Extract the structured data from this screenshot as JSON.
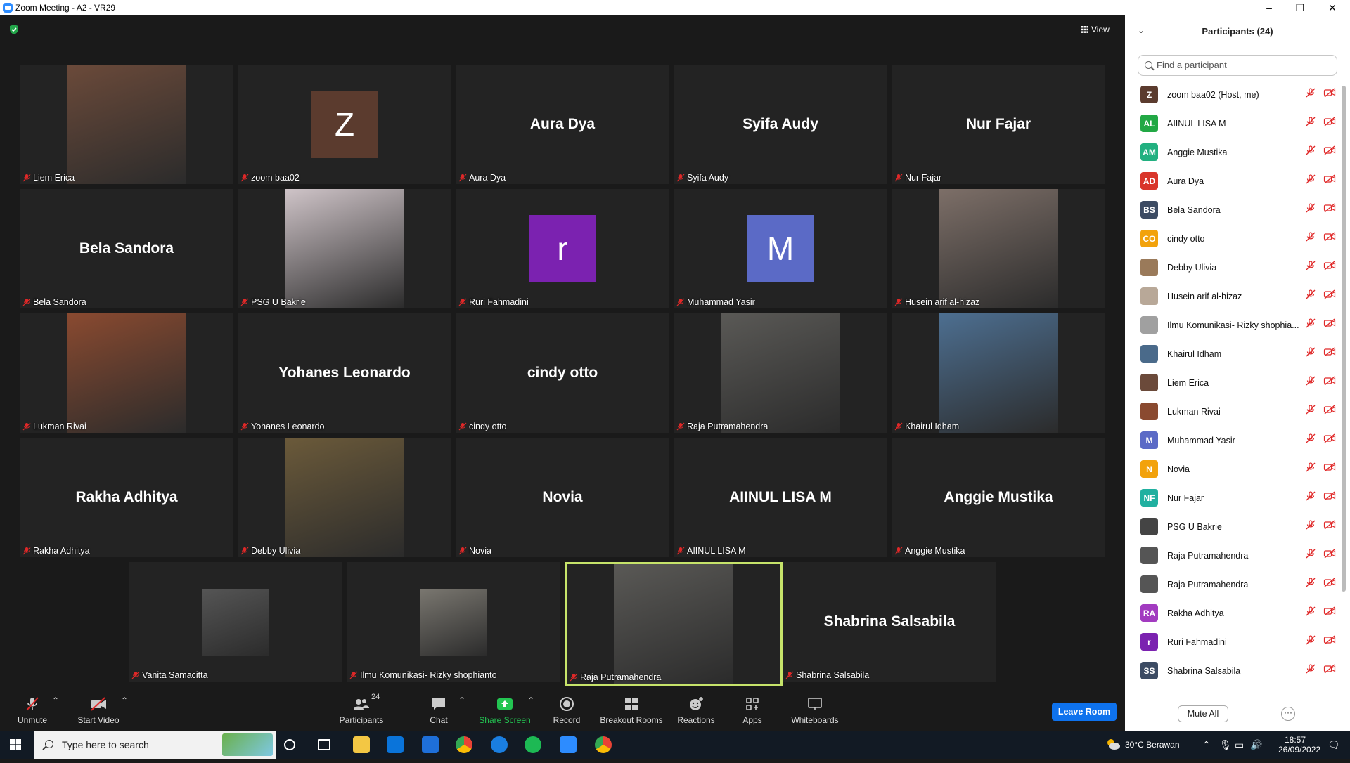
{
  "window": {
    "title": "Zoom Meeting - A2 - VR29"
  },
  "stage": {
    "view_label": "View"
  },
  "tiles": [
    {
      "label": "Liem Erica",
      "big": "",
      "avatar": "",
      "avatar_color": "",
      "photo": "#6b4a3a"
    },
    {
      "label": "zoom baa02",
      "big": "",
      "avatar": "Z",
      "avatar_color": "#5b3b2e",
      "photo": ""
    },
    {
      "label": "Aura Dya",
      "big": "Aura Dya",
      "avatar": "",
      "avatar_color": "",
      "photo": ""
    },
    {
      "label": "Syifa Audy",
      "big": "Syifa Audy",
      "avatar": "",
      "avatar_color": "",
      "photo": ""
    },
    {
      "label": "Nur Fajar",
      "big": "Nur Fajar",
      "avatar": "",
      "avatar_color": "",
      "photo": ""
    },
    {
      "label": "Bela Sandora",
      "big": "Bela Sandora",
      "avatar": "",
      "avatar_color": "",
      "photo": ""
    },
    {
      "label": "PSG U Bakrie",
      "big": "",
      "avatar": "",
      "avatar_color": "",
      "photo": "#cfc4c8"
    },
    {
      "label": "Ruri Fahmadini",
      "big": "",
      "avatar": "r",
      "avatar_color": "#7b22b0",
      "photo": ""
    },
    {
      "label": "Muhammad Yasir",
      "big": "",
      "avatar": "M",
      "avatar_color": "#5b6ac6",
      "photo": ""
    },
    {
      "label": "Husein arif al-hizaz",
      "big": "",
      "avatar": "",
      "avatar_color": "",
      "photo": "#7d6f68"
    },
    {
      "label": "Lukman Rivai",
      "big": "",
      "avatar": "",
      "avatar_color": "",
      "photo": "#8a4a30"
    },
    {
      "label": "Yohanes Leonardo",
      "big": "Yohanes Leonardo",
      "avatar": "",
      "avatar_color": "",
      "photo": ""
    },
    {
      "label": "cindy otto",
      "big": "cindy otto",
      "avatar": "",
      "avatar_color": "",
      "photo": ""
    },
    {
      "label": "Raja Putramahendra",
      "big": "",
      "avatar": "",
      "avatar_color": "",
      "photo": "#5a5956"
    },
    {
      "label": "Khairul Idham",
      "big": "",
      "avatar": "",
      "avatar_color": "",
      "photo": "#4d6f91"
    },
    {
      "label": "Rakha Adhitya",
      "big": "Rakha Adhitya",
      "avatar": "",
      "avatar_color": "",
      "photo": ""
    },
    {
      "label": "Debby Ulivia",
      "big": "",
      "avatar": "",
      "avatar_color": "",
      "photo": "#6b5a3a"
    },
    {
      "label": "Novia",
      "big": "Novia",
      "avatar": "",
      "avatar_color": "",
      "photo": ""
    },
    {
      "label": "AIINUL LISA M",
      "big": "AIINUL LISA M",
      "avatar": "",
      "avatar_color": "",
      "photo": ""
    },
    {
      "label": "Anggie Mustika",
      "big": "Anggie Mustika",
      "avatar": "",
      "avatar_color": "",
      "photo": ""
    },
    {
      "label": "Vanita Samacitta",
      "big": "",
      "avatar": "",
      "avatar_color": "",
      "photo": "#555"
    },
    {
      "label": "Ilmu Komunikasi- Rizky shophianto",
      "big": "",
      "avatar": "",
      "avatar_color": "",
      "photo": "#7a7770"
    },
    {
      "label": "Raja Putramahendra",
      "big": "",
      "avatar": "",
      "avatar_color": "",
      "photo": "#5a5956",
      "active": true
    },
    {
      "label": "Shabrina Salsabila",
      "big": "Shabrina Salsabila",
      "avatar": "",
      "avatar_color": "",
      "photo": ""
    }
  ],
  "toolbar": {
    "unmute": "Unmute",
    "start_video": "Start Video",
    "participants": "Participants",
    "participants_count": "24",
    "chat": "Chat",
    "share_screen": "Share Screen",
    "record": "Record",
    "breakout": "Breakout Rooms",
    "reactions": "Reactions",
    "apps": "Apps",
    "whiteboards": "Whiteboards",
    "leave": "Leave Room"
  },
  "panel": {
    "title": "Participants (24)",
    "search_placeholder": "Find a participant",
    "mute_all": "Mute All",
    "more": "···",
    "participants": [
      {
        "initials": "Z",
        "color": "#5b3b2e",
        "name": "zoom baa02 (Host, me)"
      },
      {
        "initials": "AL",
        "color": "#22a845",
        "name": "AIINUL LISA M"
      },
      {
        "initials": "AM",
        "color": "#22b080",
        "name": "Anggie Mustika"
      },
      {
        "initials": "AD",
        "color": "#d9362b",
        "name": "Aura Dya"
      },
      {
        "initials": "BS",
        "color": "#3c4b63",
        "name": "Bela Sandora"
      },
      {
        "initials": "CO",
        "color": "#f2a20c",
        "name": "cindy otto"
      },
      {
        "initials": "",
        "color": "#9a7a5a",
        "name": "Debby Ulivia"
      },
      {
        "initials": "",
        "color": "#b8a898",
        "name": "Husein arif al-hizaz"
      },
      {
        "initials": "",
        "color": "#a0a0a0",
        "name": "Ilmu Komunikasi- Rizky shophia..."
      },
      {
        "initials": "",
        "color": "#4a6a8a",
        "name": "Khairul Idham"
      },
      {
        "initials": "",
        "color": "#6b4a3a",
        "name": "Liem Erica"
      },
      {
        "initials": "",
        "color": "#8a4a30",
        "name": "Lukman Rivai"
      },
      {
        "initials": "M",
        "color": "#5b6ac6",
        "name": "Muhammad Yasir"
      },
      {
        "initials": "N",
        "color": "#f2a20c",
        "name": "Novia"
      },
      {
        "initials": "NF",
        "color": "#20b0a0",
        "name": "Nur Fajar"
      },
      {
        "initials": "",
        "color": "#444",
        "name": "PSG U Bakrie"
      },
      {
        "initials": "",
        "color": "#555",
        "name": "Raja Putramahendra"
      },
      {
        "initials": "",
        "color": "#555",
        "name": "Raja Putramahendra"
      },
      {
        "initials": "RA",
        "color": "#a23bc0",
        "name": "Rakha Adhitya"
      },
      {
        "initials": "r",
        "color": "#7b22b0",
        "name": "Ruri Fahmadini"
      },
      {
        "initials": "SS",
        "color": "#3c4b63",
        "name": "Shabrina Salsabila"
      }
    ]
  },
  "taskbar": {
    "search_placeholder": "Type here to search",
    "weather": "30°C  Berawan",
    "time": "18:57",
    "date": "26/09/2022"
  }
}
